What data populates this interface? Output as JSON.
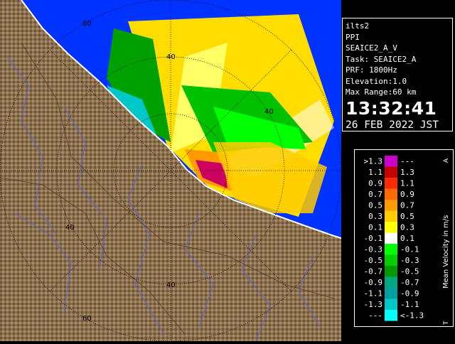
{
  "info": {
    "site": "ilts2",
    "product": "PPI",
    "product_name": "SEAICE2_A_V",
    "task": "Task: SEAICE2_A",
    "prf": "PRF: 1800Hz",
    "elevation": "Elevation:1.0",
    "max_range": "Max Range:60 km",
    "time": "13:32:41",
    "date": "26 FEB 2022 JST"
  },
  "legend": {
    "title": "Mean Velocity in m/s",
    "top_marker": "A",
    "bottom_marker": "T",
    "rows": [
      {
        "left": ">1.3",
        "right": "---",
        "color": "#cc00cc"
      },
      {
        "left": "1.1",
        "right": "1.3",
        "color": "#c40000"
      },
      {
        "left": "0.9",
        "right": "1.1",
        "color": "#ff2a00"
      },
      {
        "left": "0.7",
        "right": "0.9",
        "color": "#ff6a00"
      },
      {
        "left": "0.5",
        "right": "0.7",
        "color": "#ff9a00"
      },
      {
        "left": "0.3",
        "right": "0.5",
        "color": "#ffcc00"
      },
      {
        "left": "0.1",
        "right": "0.3",
        "color": "#ffff00"
      },
      {
        "left": "-0.1",
        "right": "0.1",
        "color": "#ffffff"
      },
      {
        "left": "-0.3",
        "right": "-0.1",
        "color": "#00ff00"
      },
      {
        "left": "-0.5",
        "right": "-0.3",
        "color": "#00cc00"
      },
      {
        "left": "-0.7",
        "right": "-0.5",
        "color": "#009900"
      },
      {
        "left": "-0.9",
        "right": "-0.7",
        "color": "#00a880"
      },
      {
        "left": "-1.1",
        "right": "-0.9",
        "color": "#00a0a0"
      },
      {
        "left": "-1.3",
        "right": "-1.1",
        "color": "#00c8c8"
      },
      {
        "left": "---",
        "right": "<-1.3",
        "color": "#00ffff"
      }
    ]
  },
  "map": {
    "range_labels": [
      "60",
      "40",
      "40",
      "40",
      "40",
      "60"
    ],
    "colors": {
      "sea": "#0033ff",
      "land": "#8a6f4e",
      "rivers": "#5a63d8",
      "roads": "#5a3a2a"
    }
  }
}
